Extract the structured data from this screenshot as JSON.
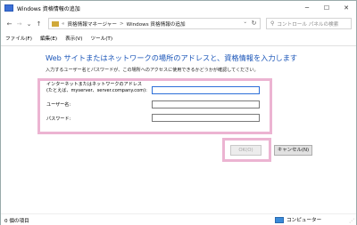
{
  "window": {
    "title": "Windows 資格情報の追加",
    "controls": {
      "minimize": "─",
      "maximize": "☐",
      "close": "✕"
    }
  },
  "address_bar": {
    "back_icon": "←",
    "forward_icon": "→",
    "recent_icon": "⌄",
    "up_icon": "↑",
    "breadcrumb_prefix": "«",
    "breadcrumbs": [
      "資格情報マネージャー",
      "Windows 資格情報の追加"
    ],
    "separator": ">",
    "dropdown_icon": "⌄",
    "refresh_icon": "↻",
    "search_placeholder": "コントロール パネルの検索",
    "search_icon": "⚲"
  },
  "menu": {
    "items": [
      "ファイル(F)",
      "編集(E)",
      "表示(V)",
      "ツール(T)"
    ]
  },
  "content": {
    "heading": "Web サイトまたはネットワークの場所のアドレスと、資格情報を入力します",
    "description": "入力するユーザー名とパスワードが、この場所へのアクセスに使用できるかどうかが確認してください。",
    "fields": {
      "address_label_1": "インターネットまたはネットワークのアドレス",
      "address_label_2": "(たとえば、myserver、server.company.com):",
      "address_value": "",
      "username_label": "ユーザー名:",
      "username_value": "",
      "password_label": "パスワード:",
      "password_value": ""
    }
  },
  "buttons": {
    "ok": "OK(O)",
    "cancel": "キャンセル(N)"
  },
  "status_bar": {
    "item_count": "0 個の項目",
    "location": "コンピューター",
    "grip": "⋰"
  },
  "colors": {
    "heading": "#1a55b8",
    "highlight": "#ecb4d2",
    "focus": "#2c6fd8"
  }
}
